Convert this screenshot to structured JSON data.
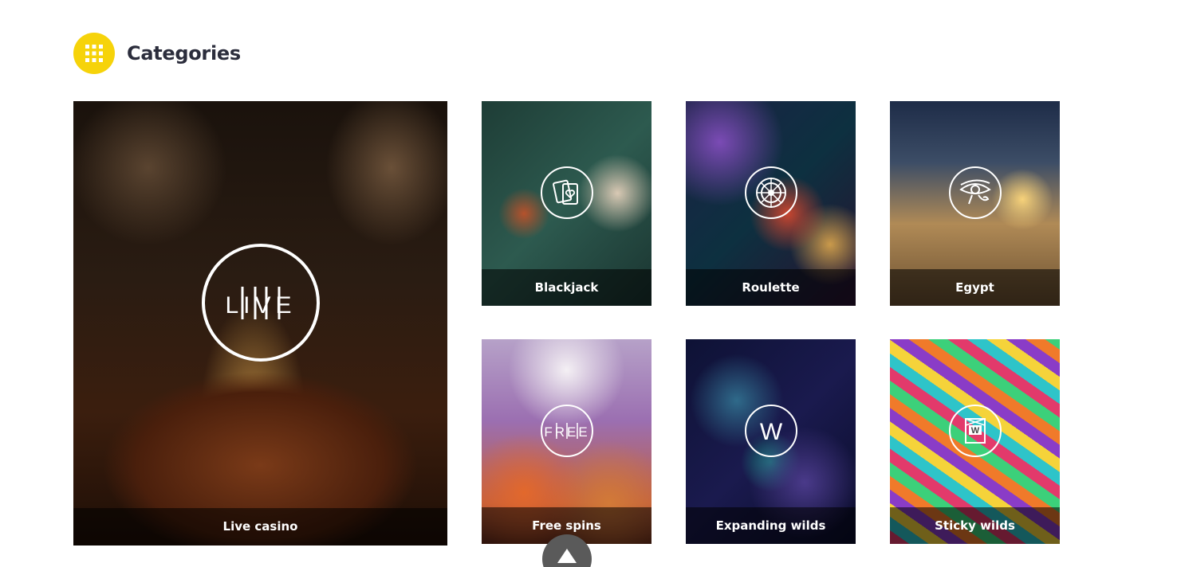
{
  "header": {
    "title": "Categories",
    "icon": "grid-icon",
    "accent_color": "#f6d30a"
  },
  "categories": [
    {
      "id": "live",
      "label": "Live casino",
      "icon": "live-icon",
      "icon_text": "LIVE"
    },
    {
      "id": "blackjack",
      "label": "Blackjack",
      "icon": "cards-icon"
    },
    {
      "id": "roulette",
      "label": "Roulette",
      "icon": "roulette-icon"
    },
    {
      "id": "egypt",
      "label": "Egypt",
      "icon": "eye-of-horus-icon"
    },
    {
      "id": "freespins",
      "label": "Free spins",
      "icon": "free-icon",
      "icon_text": "FREE"
    },
    {
      "id": "expanding",
      "label": "Expanding wilds",
      "icon": "w-icon",
      "icon_text": "W"
    },
    {
      "id": "sticky",
      "label": "Sticky wilds",
      "icon": "sticky-w-icon",
      "icon_text": "W"
    }
  ],
  "scroll_top": {
    "icon": "arrow-up-icon"
  }
}
